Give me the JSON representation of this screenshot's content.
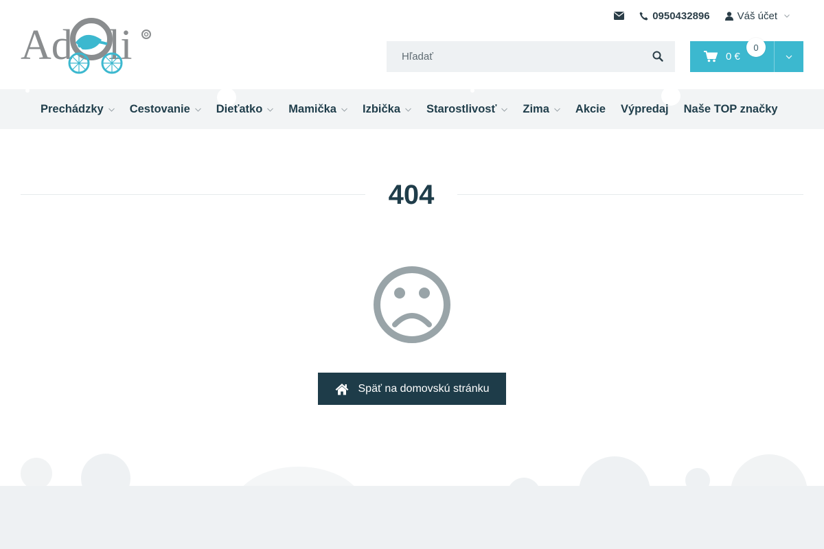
{
  "brand": {
    "logo_text": "AdCuli",
    "colors": {
      "accent": "#3cb8cf",
      "dark": "#1e3c49",
      "logo_gray": "#8a8d8f"
    }
  },
  "topbar": {
    "email_icon": "envelope-icon",
    "phone_icon": "phone-icon",
    "phone": "0950432896",
    "account_icon": "user-icon",
    "account_label": "Váš účet"
  },
  "search": {
    "placeholder": "Hľadať",
    "icon": "search-icon"
  },
  "cart": {
    "icon": "cart-icon",
    "price": "0 €",
    "count": "0"
  },
  "nav": {
    "items": [
      {
        "label": "Prechádzky",
        "has_dropdown": true
      },
      {
        "label": "Cestovanie",
        "has_dropdown": true
      },
      {
        "label": "Dieťatko",
        "has_dropdown": true
      },
      {
        "label": "Mamička",
        "has_dropdown": true
      },
      {
        "label": "Izbička",
        "has_dropdown": true
      },
      {
        "label": "Starostlivosť",
        "has_dropdown": true
      },
      {
        "label": "Zima",
        "has_dropdown": true
      },
      {
        "label": "Akcie",
        "has_dropdown": false
      },
      {
        "label": "Výpredaj",
        "has_dropdown": false
      },
      {
        "label": "Naše TOP značky",
        "has_dropdown": false
      }
    ]
  },
  "error": {
    "code": "404",
    "icon": "sad-face-icon",
    "button_label": "Späť na domovskú stránku",
    "button_icon": "home-icon"
  }
}
